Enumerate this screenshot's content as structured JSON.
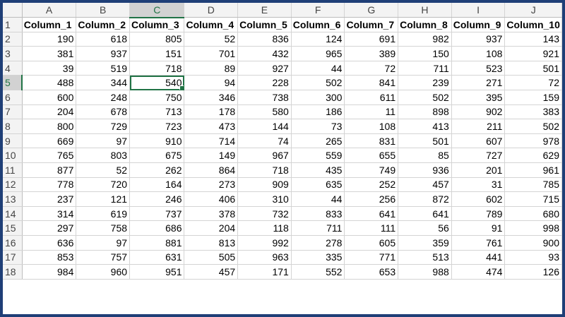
{
  "sheet": {
    "columns": [
      "A",
      "B",
      "C",
      "D",
      "E",
      "F",
      "G",
      "H",
      "I",
      "J"
    ],
    "active_cell": {
      "row": 5,
      "col": "C"
    },
    "row_numbers": [
      "1",
      "2",
      "3",
      "4",
      "5",
      "6",
      "7",
      "8",
      "9",
      "10",
      "11",
      "12",
      "13",
      "14",
      "15",
      "16",
      "17",
      "18"
    ],
    "header_row": [
      "Column_1",
      "Column_2",
      "Column_3",
      "Column_4",
      "Column_5",
      "Column_6",
      "Column_7",
      "Column_8",
      "Column_9",
      "Column_10"
    ],
    "rows": [
      [
        "190",
        "618",
        "805",
        "52",
        "836",
        "124",
        "691",
        "982",
        "937",
        "143"
      ],
      [
        "381",
        "937",
        "151",
        "701",
        "432",
        "965",
        "389",
        "150",
        "108",
        "921"
      ],
      [
        "39",
        "519",
        "718",
        "89",
        "927",
        "44",
        "72",
        "711",
        "523",
        "501"
      ],
      [
        "488",
        "344",
        "540",
        "94",
        "228",
        "502",
        "841",
        "239",
        "271",
        "72"
      ],
      [
        "600",
        "248",
        "750",
        "346",
        "738",
        "300",
        "611",
        "502",
        "395",
        "159"
      ],
      [
        "204",
        "678",
        "713",
        "178",
        "580",
        "186",
        "11",
        "898",
        "902",
        "383"
      ],
      [
        "800",
        "729",
        "723",
        "473",
        "144",
        "73",
        "108",
        "413",
        "211",
        "502"
      ],
      [
        "669",
        "97",
        "910",
        "714",
        "74",
        "265",
        "831",
        "501",
        "607",
        "978"
      ],
      [
        "765",
        "803",
        "675",
        "149",
        "967",
        "559",
        "655",
        "85",
        "727",
        "629"
      ],
      [
        "877",
        "52",
        "262",
        "864",
        "718",
        "435",
        "749",
        "936",
        "201",
        "961"
      ],
      [
        "778",
        "720",
        "164",
        "273",
        "909",
        "635",
        "252",
        "457",
        "31",
        "785"
      ],
      [
        "237",
        "121",
        "246",
        "406",
        "310",
        "44",
        "256",
        "872",
        "602",
        "715"
      ],
      [
        "314",
        "619",
        "737",
        "378",
        "732",
        "833",
        "641",
        "641",
        "789",
        "680"
      ],
      [
        "297",
        "758",
        "686",
        "204",
        "118",
        "711",
        "111",
        "56",
        "91",
        "998"
      ],
      [
        "636",
        "97",
        "881",
        "813",
        "992",
        "278",
        "605",
        "359",
        "761",
        "900"
      ],
      [
        "853",
        "757",
        "631",
        "505",
        "963",
        "335",
        "771",
        "513",
        "441",
        "93"
      ],
      [
        "984",
        "960",
        "951",
        "457",
        "171",
        "552",
        "653",
        "988",
        "474",
        "126"
      ]
    ]
  },
  "colors": {
    "frame_border": "#1f3f77",
    "selection_green": "#217346",
    "header_bg": "#f3f3f3",
    "gridline": "#d4d4d4"
  }
}
